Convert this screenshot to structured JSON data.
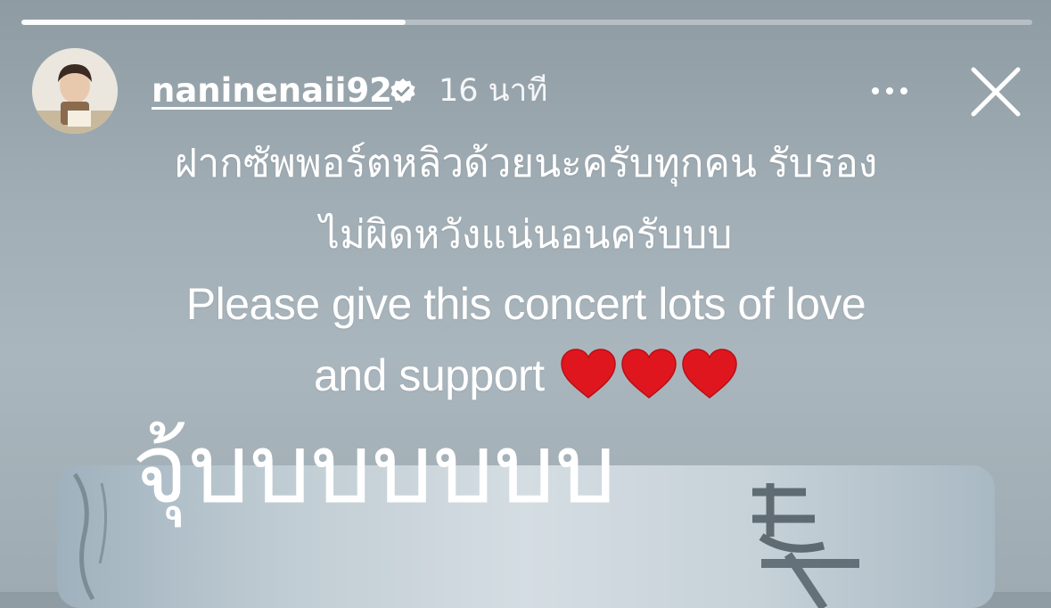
{
  "story": {
    "progress": 0.38,
    "username": "naninenaii92",
    "verified": true,
    "timestamp": "16 นาที",
    "caption": {
      "line1": "ฝากซัพพอร์ตหลิวด้วยนะครับทุกคน รับรอง",
      "line2": "ไม่ผิดหวังแน่นอนครับบบ",
      "line3": "Please give this concert lots of love",
      "line4": "and support"
    },
    "hearts": [
      "heart-icon",
      "heart-icon",
      "heart-icon"
    ],
    "overlay_text": "จุ้บบบบบบบ"
  },
  "colors": {
    "heart": "#e0161f",
    "accent": "#ffffff"
  },
  "icons": {
    "more": "more-options-icon",
    "close": "close-icon",
    "verified": "verified-badge-icon"
  }
}
